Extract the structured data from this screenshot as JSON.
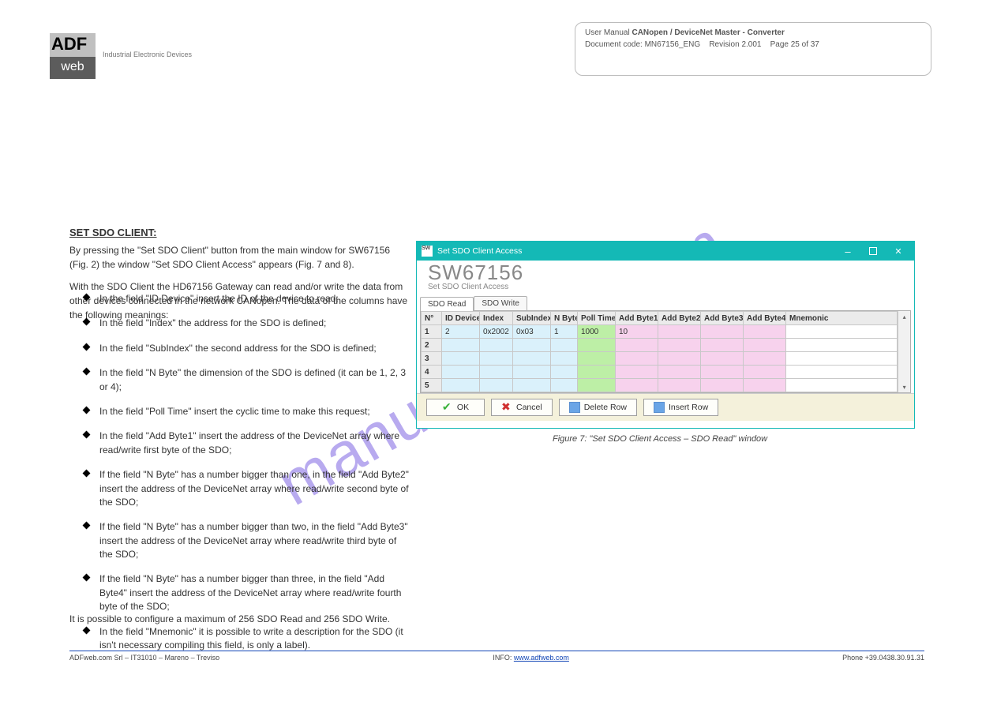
{
  "logo": {
    "top": "ADF",
    "bot": "web"
  },
  "industrial_line": "Industrial Electronic Devices",
  "docinfo": {
    "l1": "User Manual",
    "l2": "CANopen / DeviceNet Master - Converter",
    "l3a": "Document code: MN67156_ENG",
    "l3b": "Revision 2.001",
    "l3c": "Page 25 of 37"
  },
  "watermark": "manualshive.com",
  "section_title": "SET SDO CLIENT:",
  "intro": "By pressing the \"Set SDO Client\" button from the main window for SW67156 (Fig. 2) the window \"Set SDO Client Access\" appears (Fig. 7 and 8).",
  "para2": "With the SDO Client the HD67156 Gateway can read and/or write the data from other devices connected in the network CANopen. The data of the columns have the following meanings:",
  "bullets": [
    "In the field \"ID Device\" insert the ID of the device to read;",
    "In the field \"Index\" the address for the SDO is defined;",
    "In the field \"SubIndex\" the second address for the SDO is defined;",
    "In the field \"N Byte\" the dimension of the SDO is defined (it can be 1, 2, 3 or 4);",
    "In the field \"Poll Time\" insert the cyclic time to make this request;",
    "In the field \"Add Byte1\" insert the address of the DeviceNet array where read/write first byte of the SDO;",
    "If the field \"N Byte\" has a number bigger than one, in the field \"Add Byte2\" insert the address of the DeviceNet array where read/write second byte of the SDO;",
    "If the field \"N Byte\" has a number bigger than two, in the field \"Add Byte3\" insert the address of the DeviceNet array where read/write third byte of the SDO;",
    "If the field \"N Byte\" has a number bigger than three, in the field \"Add Byte4\" insert the address of the DeviceNet array where read/write fourth byte of the SDO;",
    "In the field \"Mnemonic\" it is possible to write a description for the SDO (it isn't necessary compiling this field, is only a label)."
  ],
  "note": "It is possible to configure a maximum of 256 SDO Read and 256 SDO Write.",
  "dialog": {
    "title": "Set SDO Client Access",
    "swnum": "SW67156",
    "swsub": "Set SDO Client Access",
    "tab_read": "SDO Read",
    "tab_write": "SDO Write",
    "headers": [
      "N°",
      "ID Device",
      "Index",
      "SubIndex",
      "N Byte",
      "Poll Time",
      "Add Byte1",
      "Add Byte2",
      "Add Byte3",
      "Add Byte4",
      "Mnemonic"
    ],
    "rows": [
      {
        "n": "1",
        "id": "2",
        "idx": "0x2002",
        "sub": "0x03",
        "nbyte": "1",
        "poll": "1000",
        "b1": "10",
        "b2": "",
        "b3": "",
        "b4": "",
        "mnem": ""
      },
      {
        "n": "2",
        "id": "",
        "idx": "",
        "sub": "",
        "nbyte": "",
        "poll": "",
        "b1": "",
        "b2": "",
        "b3": "",
        "b4": "",
        "mnem": ""
      },
      {
        "n": "3",
        "id": "",
        "idx": "",
        "sub": "",
        "nbyte": "",
        "poll": "",
        "b1": "",
        "b2": "",
        "b3": "",
        "b4": "",
        "mnem": ""
      },
      {
        "n": "4",
        "id": "",
        "idx": "",
        "sub": "",
        "nbyte": "",
        "poll": "",
        "b1": "",
        "b2": "",
        "b3": "",
        "b4": "",
        "mnem": ""
      },
      {
        "n": "5",
        "id": "",
        "idx": "",
        "sub": "",
        "nbyte": "",
        "poll": "",
        "b1": "",
        "b2": "",
        "b3": "",
        "b4": "",
        "mnem": ""
      }
    ],
    "ok": "OK",
    "cancel": "Cancel",
    "delrow": "Delete Row",
    "insrow": "Insert Row"
  },
  "fig_caption": "Figure 7: \"Set SDO Client Access – SDO Read\" window",
  "footer": {
    "left": "ADFweb.com Srl – IT31010 – Mareno – Treviso",
    "mid_label": "INFO:",
    "mid_link": "www.adfweb.com",
    "right": "Phone +39.0438.30.91.31"
  }
}
